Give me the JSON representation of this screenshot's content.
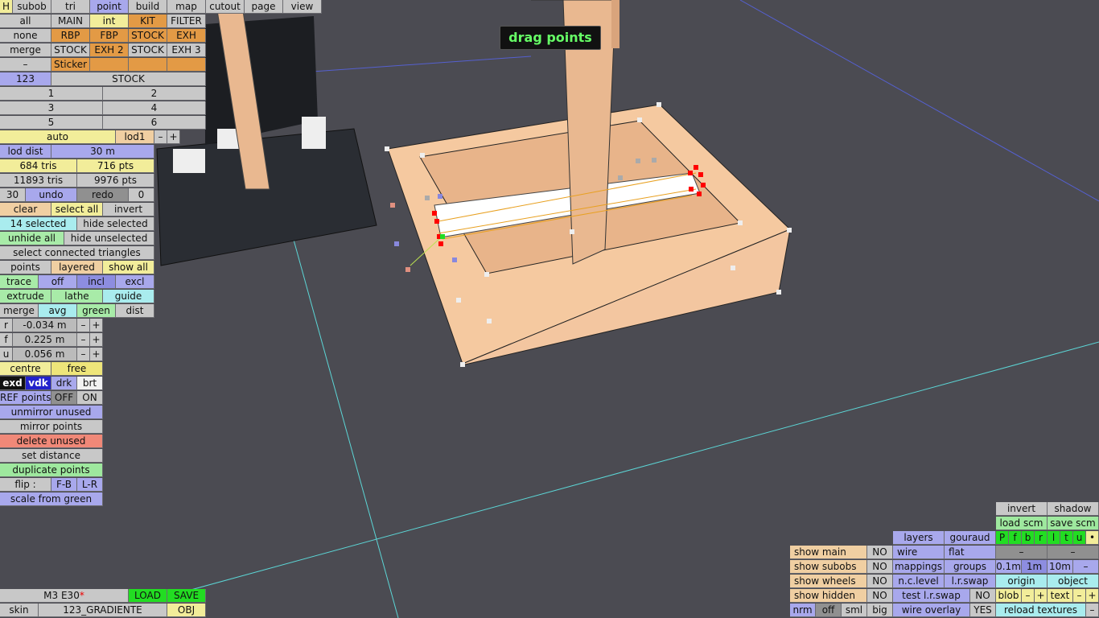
{
  "tooltip": "drag points",
  "top": {
    "h": "H",
    "subob": "subob",
    "tri": "tri",
    "point": "point",
    "build": "build",
    "map": "map",
    "cutout": "cutout",
    "page": "page",
    "view": "view"
  },
  "sel": {
    "all": "all",
    "main": "MAIN",
    "int": "int",
    "kit": "KIT",
    "filter": "FILTER",
    "none": "none",
    "rbp": "RBP",
    "fbp": "FBP",
    "stock1": "STOCK",
    "exh": "EXH",
    "merge": "merge",
    "stock2": "STOCK",
    "exh2": "EXH 2",
    "stock3": "STOCK",
    "exh3": "EXH 3",
    "minus": "–",
    "sticker": "Sticker"
  },
  "num": {
    "n123": "123",
    "stock": "STOCK",
    "one": "1",
    "two": "2",
    "three": "3",
    "four": "4",
    "five": "5",
    "six": "6"
  },
  "lod": {
    "auto": "auto",
    "lod1": "lod1",
    "minus": "–",
    "plus": "+",
    "lod_dist": "lod dist",
    "dist_val": "30 m",
    "tris": "684 tris",
    "pts": "716 pts",
    "total_tris": "11893 tris",
    "total_pts": "9976 pts"
  },
  "undo": {
    "n30": "30",
    "undo": "undo",
    "redo": "redo",
    "zero": "0"
  },
  "ops": {
    "clear": "clear",
    "select_all": "select all",
    "invert": "invert",
    "selected": "14 selected",
    "hide_selected": "hide selected",
    "unhide_all": "unhide all",
    "hide_unselected": "hide unselected",
    "select_connected": "select connected triangles",
    "points": "points",
    "layered": "layered",
    "show_all": "show all",
    "trace": "trace",
    "off": "off",
    "incl": "incl",
    "excl": "excl",
    "extrude": "extrude",
    "lathe": "lathe",
    "guide": "guide",
    "merge": "merge",
    "avg": "avg",
    "green": "green",
    "dist": "dist"
  },
  "coords": {
    "r_label": "r",
    "r_val": "-0.034 m",
    "f_label": "f",
    "f_val": "0.225 m",
    "u_label": "u",
    "u_val": "0.056 m",
    "minus": "–",
    "plus": "+"
  },
  "centre": {
    "centre": "centre",
    "free": "free",
    "exd": "exd",
    "vdk": "vdk",
    "drk": "drk",
    "brt": "brt",
    "ref_points": "REF points",
    "off": "OFF",
    "on": "ON"
  },
  "actions": {
    "unmirror": "unmirror unused",
    "mirror": "mirror points",
    "delete": "delete unused",
    "set_distance": "set distance",
    "duplicate": "duplicate points",
    "flip": "flip :",
    "fb": "F-B",
    "lr": "L-R",
    "scale": "scale from green"
  },
  "bottom_left": {
    "car": "M3 E30",
    "star": "*",
    "load": "LOAD",
    "save": "SAVE",
    "skin": "skin",
    "skin_name": "123_GRADIENTE",
    "obj": "OBJ"
  },
  "bottom_right": {
    "invert": "invert",
    "shadow": "shadow",
    "load_scm": "load scm",
    "save_scm": "save scm",
    "layers": "layers",
    "gouraud": "gouraud",
    "p": "P",
    "f": "f",
    "b": "b",
    "r": "r",
    "l": "l",
    "t": "t",
    "u": "u",
    "dot": "•",
    "show_main": "show main",
    "no1": "NO",
    "wire": "wire",
    "flat": "flat",
    "dash1": "–",
    "dash2": "–",
    "show_subobs": "show subobs",
    "no2": "NO",
    "mappings": "mappings",
    "groups": "groups",
    "s01": "0.1m",
    "s1": "1m",
    "s10": "10m",
    "sminus": "–",
    "show_wheels": "show wheels",
    "no3": "NO",
    "nclevel": "n.c.level",
    "lrswap": "l.r.swap",
    "origin": "origin",
    "object": "object",
    "show_hidden": "show hidden",
    "no4": "NO",
    "test_lr": "test l.r.swap",
    "no5": "NO",
    "blob": "blob",
    "text": "text",
    "nrm": "nrm",
    "off": "off",
    "sml": "sml",
    "big": "big",
    "wire_overlay": "wire overlay",
    "yes": "YES",
    "reload": "reload textures",
    "rminus": "–"
  },
  "colors": {
    "background": "#4b4b52",
    "model": "#f5c9a0",
    "tooltip_text": "#66ff66",
    "selected_point": "#ff0000",
    "green_point": "#22dd22"
  }
}
